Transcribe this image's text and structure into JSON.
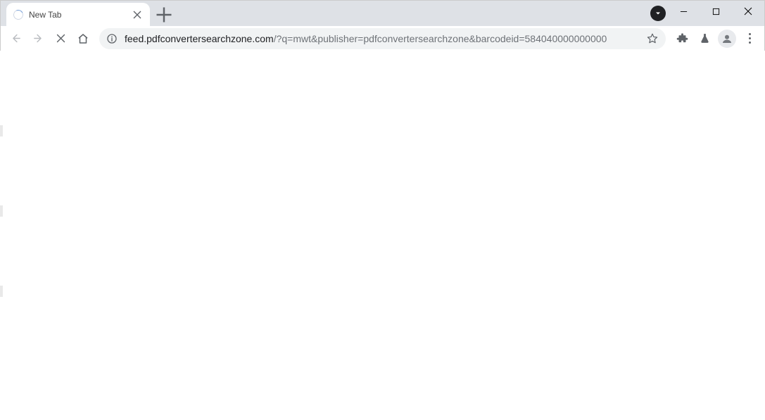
{
  "tab": {
    "title": "New Tab"
  },
  "url": {
    "host": "feed.pdfconvertersearchzone.com",
    "path": "/?q=mwt&publisher=pdfconvertersearchzone&barcodeid=584040000000000"
  }
}
